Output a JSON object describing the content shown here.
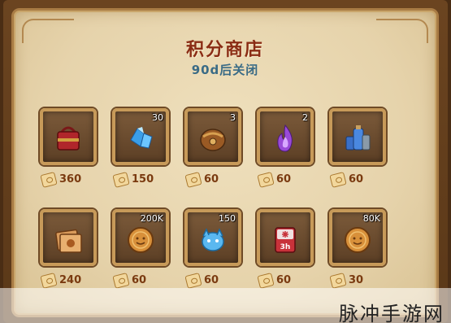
{
  "shop": {
    "title": "积分商店",
    "subtitle": "90d后关闭"
  },
  "items": [
    {
      "icon": "red-bag-icon",
      "count": "",
      "cost": "360"
    },
    {
      "icon": "blue-crystal-icon",
      "count": "30",
      "cost": "150"
    },
    {
      "icon": "bronze-chest-icon",
      "count": "3",
      "cost": "60"
    },
    {
      "icon": "purple-flame-icon",
      "count": "2",
      "cost": "60"
    },
    {
      "icon": "blue-potion-set-icon",
      "count": "",
      "cost": "60"
    },
    {
      "icon": "scroll-book-icon",
      "count": "",
      "cost": "240"
    },
    {
      "icon": "gold-coin-icon",
      "count": "200K",
      "cost": "60"
    },
    {
      "icon": "blue-spirit-icon",
      "count": "150",
      "cost": "60"
    },
    {
      "icon": "speedup-3h-icon",
      "count": "",
      "cost": "60"
    },
    {
      "icon": "gold-coin-icon",
      "count": "80K",
      "cost": "30"
    }
  ],
  "speedup_label": "3h",
  "watermark": "脉冲手游网"
}
